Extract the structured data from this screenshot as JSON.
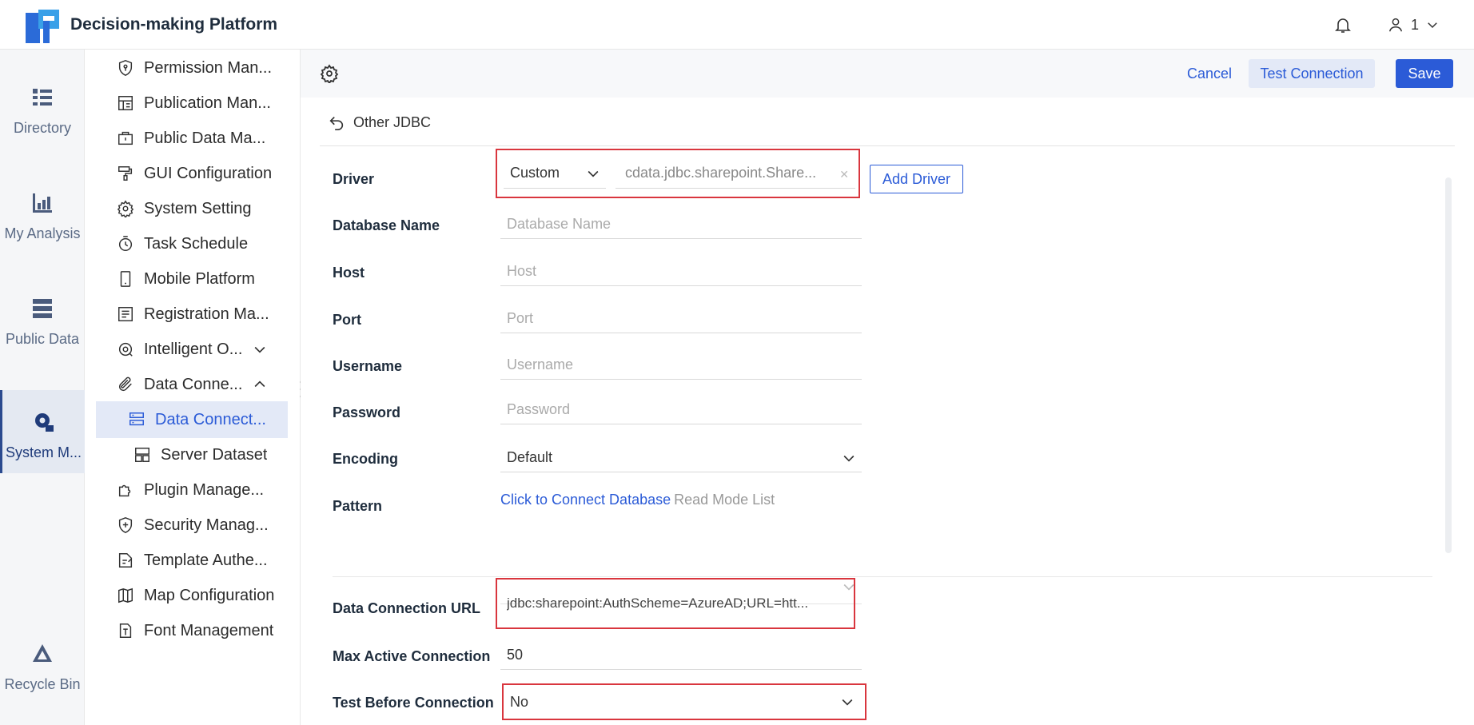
{
  "app": {
    "title": "Decision-making Platform",
    "user_label": "1"
  },
  "rail": [
    {
      "label": "Directory"
    },
    {
      "label": "My Analysis"
    },
    {
      "label": "Public Data"
    },
    {
      "label": "System M..."
    },
    {
      "label": "Recycle Bin"
    }
  ],
  "sidebar": {
    "items": [
      {
        "label": "Permission Man..."
      },
      {
        "label": "Publication Man..."
      },
      {
        "label": "Public Data Ma..."
      },
      {
        "label": "GUI Configuration"
      },
      {
        "label": "System Setting"
      },
      {
        "label": "Task Schedule"
      },
      {
        "label": "Mobile Platform"
      },
      {
        "label": "Registration Ma..."
      },
      {
        "label": "Intelligent O..."
      },
      {
        "label": "Data Conne..."
      },
      {
        "label": "Data Connect..."
      },
      {
        "label": "Server Dataset"
      },
      {
        "label": "Plugin Manage..."
      },
      {
        "label": "Security Manag..."
      },
      {
        "label": "Template Authe..."
      },
      {
        "label": "Map Configuration"
      },
      {
        "label": "Font Management"
      }
    ]
  },
  "toolbar": {
    "cancel_label": "Cancel",
    "test_label": "Test Connection",
    "save_label": "Save"
  },
  "form": {
    "back_label": "Other JDBC",
    "driver": {
      "label": "Driver",
      "type": "Custom",
      "value": "cdata.jdbc.sharepoint.Share...",
      "add_label": "Add Driver"
    },
    "database_name": {
      "label": "Database Name",
      "placeholder": "Database Name"
    },
    "host": {
      "label": "Host",
      "placeholder": "Host"
    },
    "port": {
      "label": "Port",
      "placeholder": "Port"
    },
    "username": {
      "label": "Username",
      "placeholder": "Username"
    },
    "password": {
      "label": "Password",
      "placeholder": "Password"
    },
    "encoding": {
      "label": "Encoding",
      "value": "Default"
    },
    "pattern": {
      "label": "Pattern",
      "link": "Click to Connect Database",
      "hint": "Read Mode List"
    },
    "url": {
      "label": "Data Connection URL",
      "value": "jdbc:sharepoint:AuthScheme=AzureAD;URL=htt..."
    },
    "max_active": {
      "label": "Max Active Connection",
      "value": "50"
    },
    "test_before": {
      "label": "Test Before Connection",
      "value": "No"
    }
  }
}
